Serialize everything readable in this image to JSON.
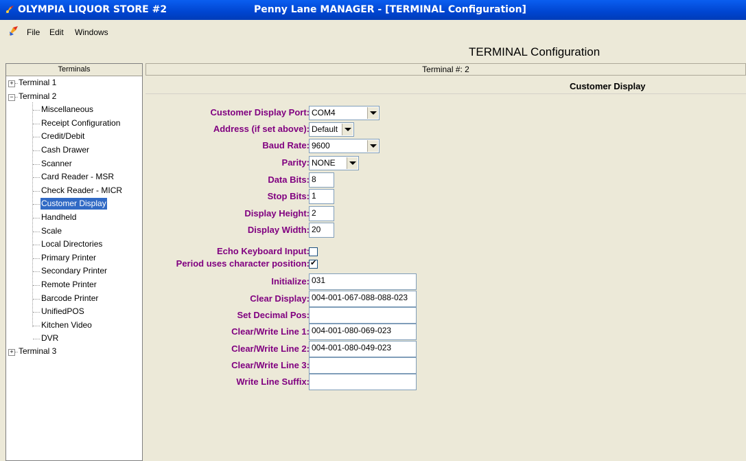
{
  "window": {
    "store_name": "OLYMPIA LIQUOR STORE #2",
    "title": "Penny Lane MANAGER - [TERMINAL Configuration]"
  },
  "menu": {
    "file": "File",
    "edit": "Edit",
    "windows": "Windows"
  },
  "page_title": "TERMINAL Configuration",
  "left_panel": {
    "header": "Terminals",
    "terminal1": "Terminal 1",
    "terminal2": "Terminal 2",
    "terminal3": "Terminal 3",
    "terminal2_children": [
      "Miscellaneous",
      "Receipt Configuration",
      "Credit/Debit",
      "Cash Drawer",
      "Scanner",
      "Card Reader - MSR",
      "Check Reader - MICR",
      "Customer Display",
      "Handheld",
      "Scale",
      "Local Directories",
      "Primary Printer",
      "Secondary Printer",
      "Remote Printer",
      "Barcode Printer",
      "UnifiedPOS",
      "Kitchen Video",
      "DVR"
    ],
    "selected": "Customer Display"
  },
  "right_panel": {
    "terminal_label": "Terminal #: 2",
    "section_title": "Customer Display"
  },
  "form": {
    "customer_display_port": {
      "label": "Customer Display Port:",
      "value": "COM4"
    },
    "address": {
      "label": "Address (if set above):",
      "value": "Default"
    },
    "baud_rate": {
      "label": "Baud Rate:",
      "value": "9600"
    },
    "parity": {
      "label": "Parity:",
      "value": "NONE"
    },
    "data_bits": {
      "label": "Data Bits:",
      "value": "8"
    },
    "stop_bits": {
      "label": "Stop Bits:",
      "value": "1"
    },
    "display_height": {
      "label": "Display Height:",
      "value": "2"
    },
    "display_width": {
      "label": "Display Width:",
      "value": "20"
    },
    "echo_keyboard_input": {
      "label": "Echo Keyboard Input:",
      "checked": false
    },
    "period_uses_char_pos": {
      "label": "Period uses character position:",
      "checked": true
    },
    "initialize": {
      "label": "Initialize:",
      "value": "031"
    },
    "clear_display": {
      "label": "Clear Display:",
      "value": "004-001-067-088-088-023"
    },
    "set_decimal_pos": {
      "label": "Set Decimal Pos:",
      "value": ""
    },
    "clear_write_line1": {
      "label": "Clear/Write Line 1:",
      "value": "004-001-080-069-023"
    },
    "clear_write_line2": {
      "label": "Clear/Write Line 2:",
      "value": "004-001-080-049-023"
    },
    "clear_write_line3": {
      "label": "Clear/Write Line 3:",
      "value": ""
    },
    "write_line_suffix": {
      "label": "Write Line Suffix:",
      "value": ""
    }
  }
}
